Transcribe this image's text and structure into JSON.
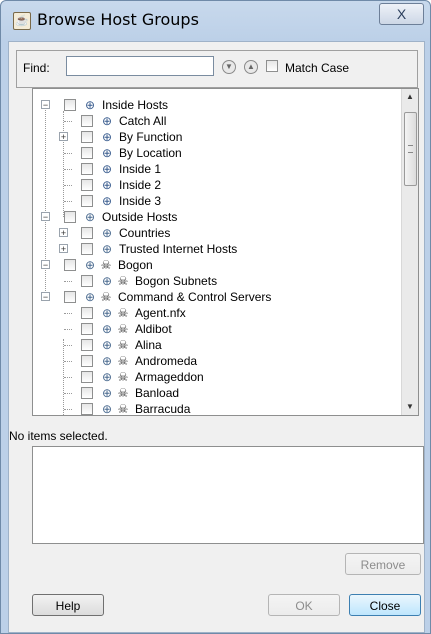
{
  "window": {
    "title": "Browse Host Groups",
    "close_glyph": "X"
  },
  "find": {
    "label": "Find:",
    "value": "",
    "match_case_label": "Match Case",
    "match_case_checked": false
  },
  "tree": {
    "items": [
      {
        "label": "Inside Hosts",
        "icon": "inside-hosts-icon",
        "expander": "−"
      },
      {
        "label": "Catch All",
        "icon": "inside-hosts-icon",
        "expander": ""
      },
      {
        "label": "By Function",
        "icon": "inside-hosts-icon",
        "expander": "+"
      },
      {
        "label": "By Location",
        "icon": "inside-hosts-icon",
        "expander": ""
      },
      {
        "label": "Inside 1",
        "icon": "inside-hosts-icon",
        "expander": ""
      },
      {
        "label": "Inside 2",
        "icon": "inside-hosts-icon",
        "expander": ""
      },
      {
        "label": "Inside 3",
        "icon": "inside-hosts-icon",
        "expander": ""
      },
      {
        "label": "Outside Hosts",
        "icon": "globe-icon",
        "expander": "−"
      },
      {
        "label": "Countries",
        "icon": "globe-icon",
        "expander": "+"
      },
      {
        "label": "Trusted Internet Hosts",
        "icon": "globe-icon",
        "expander": "+"
      },
      {
        "label": "Bogon",
        "icon": "skull-icon",
        "expander": "−"
      },
      {
        "label": "Bogon Subnets",
        "icon": "skull-icon",
        "expander": ""
      },
      {
        "label": "Command & Control Servers",
        "icon": "skull-icon",
        "expander": "−"
      },
      {
        "label": "Agent.nfx",
        "icon": "skull-icon",
        "expander": ""
      },
      {
        "label": "Aldibot",
        "icon": "skull-icon",
        "expander": ""
      },
      {
        "label": "Alina",
        "icon": "skull-icon",
        "expander": ""
      },
      {
        "label": "Andromeda",
        "icon": "skull-icon",
        "expander": ""
      },
      {
        "label": "Armageddon",
        "icon": "skull-icon",
        "expander": ""
      },
      {
        "label": "Banload",
        "icon": "skull-icon",
        "expander": ""
      },
      {
        "label": "Barracuda",
        "icon": "skull-icon",
        "expander": ""
      }
    ]
  },
  "status": "No items selected.",
  "buttons": {
    "remove": "Remove",
    "help": "Help",
    "ok": "OK",
    "close": "Close"
  }
}
